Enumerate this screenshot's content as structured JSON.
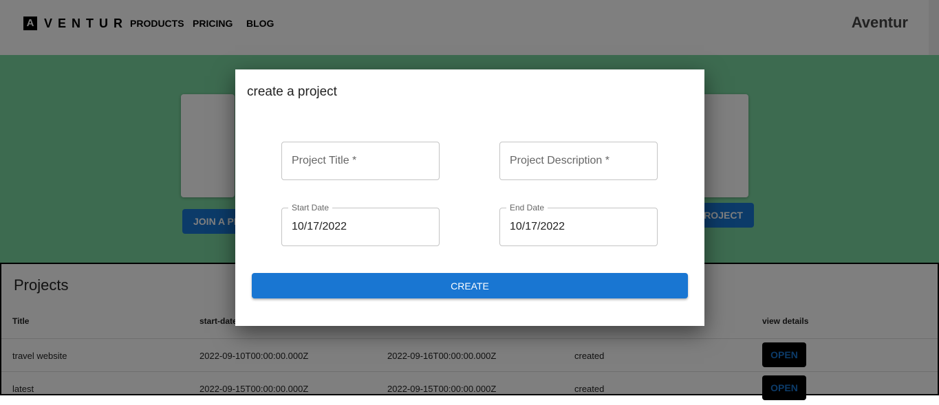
{
  "header": {
    "logo_letter": "A",
    "logo_text": "VENTUR",
    "nav": [
      "PRODUCTS",
      "PRICING",
      "BLOG"
    ],
    "brand": "Aventur"
  },
  "hero": {
    "join_label": "JOIN A PROJECT",
    "create_label": "CREATE PROJECT",
    "color": "#7bd6a0"
  },
  "projects": {
    "title": "Projects",
    "headers": [
      "Title",
      "start-date",
      "",
      "",
      "view details"
    ],
    "rows": [
      {
        "title": "travel website",
        "start": "2022-09-10T00:00:00.000Z",
        "end": "2022-09-16T00:00:00.000Z",
        "status": "created",
        "action": "OPEN"
      },
      {
        "title": "latest",
        "start": "2022-09-15T00:00:00.000Z",
        "end": "2022-09-15T00:00:00.000Z",
        "status": "created",
        "action": "OPEN"
      }
    ]
  },
  "modal": {
    "title": "create a project",
    "project_title_placeholder": "Project Title *",
    "project_description_placeholder": "Project Description *",
    "start_label": "Start Date",
    "start_value": "10/17/2022",
    "end_label": "End Date",
    "end_value": "10/17/2022",
    "create_label": "CREATE",
    "accent": "#1976d2"
  }
}
